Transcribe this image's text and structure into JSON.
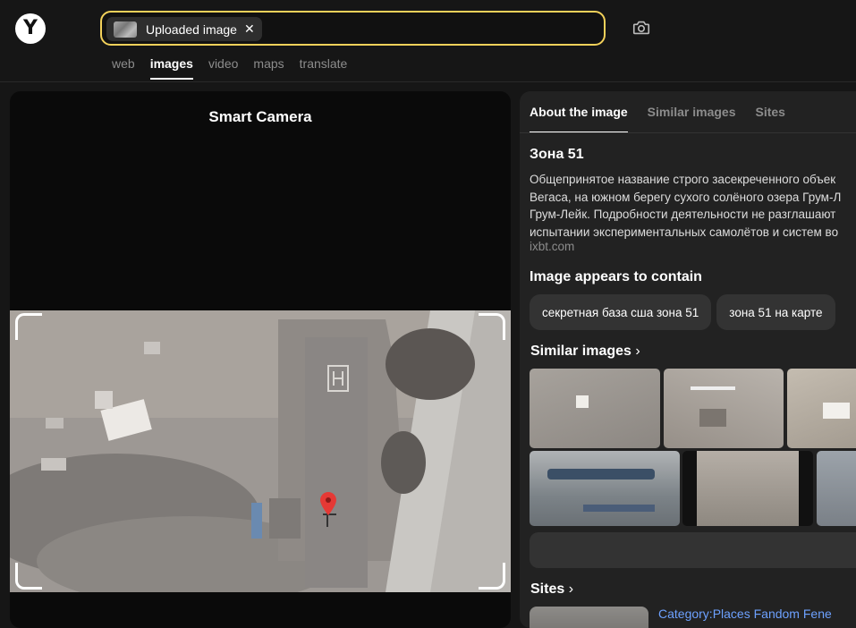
{
  "header": {
    "logo_letter": "Y",
    "search_chip_label": "Uploaded image",
    "chip_close": "✕",
    "camera_icon": "camera-icon",
    "tabs": [
      "web",
      "images",
      "video",
      "maps",
      "translate"
    ],
    "active_tab": "images"
  },
  "left": {
    "title": "Smart Camera"
  },
  "right": {
    "tabs": [
      "About the image",
      "Similar images",
      "Sites"
    ],
    "active_tab": "About the image",
    "about_title": "Зона 51",
    "about_lines": [
      "Общепринятое название строго засекреченного объек",
      "Вегаса, на южном берегу сухого солёного озера Грум-Л",
      "Грум-Лейк. Подробности деятельности не разглашают",
      "испытании экспериментальных самолётов и систем во"
    ],
    "about_source": "ixbt.com",
    "contain_title": "Image appears to contain",
    "pills": [
      "секретная база сша зона 51",
      "зона 51 на карте"
    ],
    "similar_title": "Similar images",
    "sites_title": "Sites",
    "site_link": "Category:Places Fandom Fene"
  },
  "colors": {
    "accent": "#f3d15a",
    "link": "#6da1ff",
    "pin": "#e53935"
  }
}
